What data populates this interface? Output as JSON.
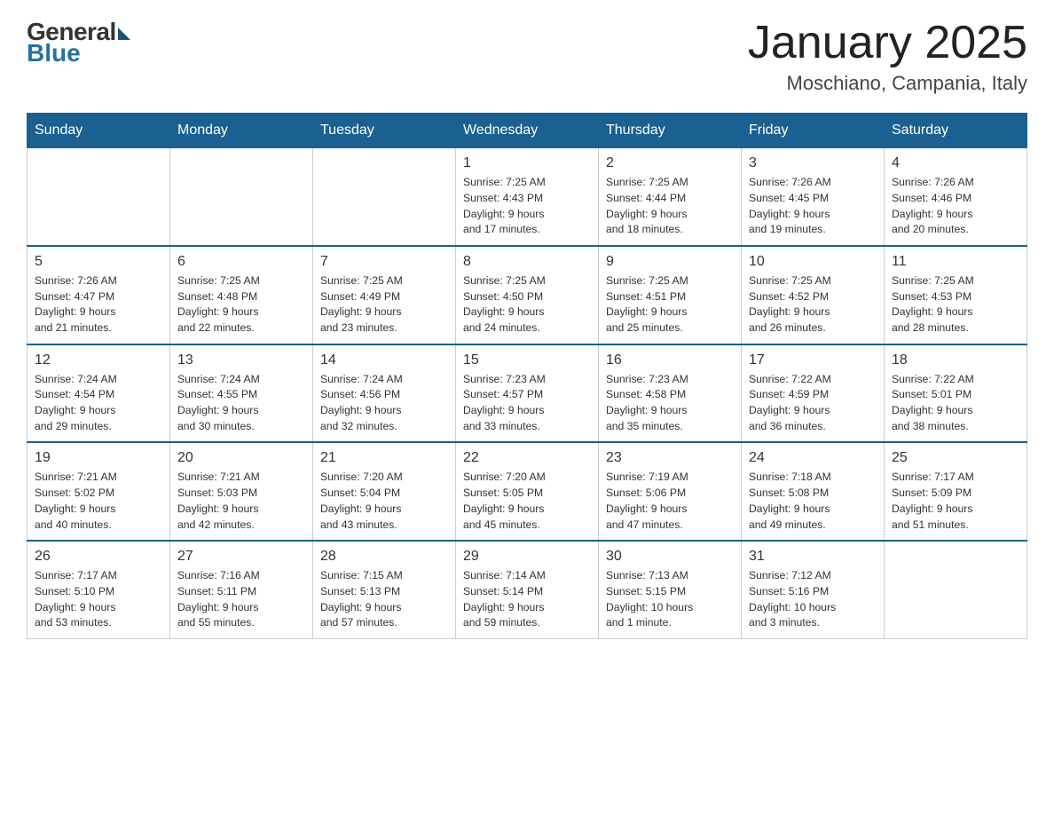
{
  "header": {
    "logo_general": "General",
    "logo_blue": "Blue",
    "month_title": "January 2025",
    "location": "Moschiano, Campania, Italy"
  },
  "days_of_week": [
    "Sunday",
    "Monday",
    "Tuesday",
    "Wednesday",
    "Thursday",
    "Friday",
    "Saturday"
  ],
  "weeks": [
    [
      {
        "day": "",
        "info": ""
      },
      {
        "day": "",
        "info": ""
      },
      {
        "day": "",
        "info": ""
      },
      {
        "day": "1",
        "info": "Sunrise: 7:25 AM\nSunset: 4:43 PM\nDaylight: 9 hours\nand 17 minutes."
      },
      {
        "day": "2",
        "info": "Sunrise: 7:25 AM\nSunset: 4:44 PM\nDaylight: 9 hours\nand 18 minutes."
      },
      {
        "day": "3",
        "info": "Sunrise: 7:26 AM\nSunset: 4:45 PM\nDaylight: 9 hours\nand 19 minutes."
      },
      {
        "day": "4",
        "info": "Sunrise: 7:26 AM\nSunset: 4:46 PM\nDaylight: 9 hours\nand 20 minutes."
      }
    ],
    [
      {
        "day": "5",
        "info": "Sunrise: 7:26 AM\nSunset: 4:47 PM\nDaylight: 9 hours\nand 21 minutes."
      },
      {
        "day": "6",
        "info": "Sunrise: 7:25 AM\nSunset: 4:48 PM\nDaylight: 9 hours\nand 22 minutes."
      },
      {
        "day": "7",
        "info": "Sunrise: 7:25 AM\nSunset: 4:49 PM\nDaylight: 9 hours\nand 23 minutes."
      },
      {
        "day": "8",
        "info": "Sunrise: 7:25 AM\nSunset: 4:50 PM\nDaylight: 9 hours\nand 24 minutes."
      },
      {
        "day": "9",
        "info": "Sunrise: 7:25 AM\nSunset: 4:51 PM\nDaylight: 9 hours\nand 25 minutes."
      },
      {
        "day": "10",
        "info": "Sunrise: 7:25 AM\nSunset: 4:52 PM\nDaylight: 9 hours\nand 26 minutes."
      },
      {
        "day": "11",
        "info": "Sunrise: 7:25 AM\nSunset: 4:53 PM\nDaylight: 9 hours\nand 28 minutes."
      }
    ],
    [
      {
        "day": "12",
        "info": "Sunrise: 7:24 AM\nSunset: 4:54 PM\nDaylight: 9 hours\nand 29 minutes."
      },
      {
        "day": "13",
        "info": "Sunrise: 7:24 AM\nSunset: 4:55 PM\nDaylight: 9 hours\nand 30 minutes."
      },
      {
        "day": "14",
        "info": "Sunrise: 7:24 AM\nSunset: 4:56 PM\nDaylight: 9 hours\nand 32 minutes."
      },
      {
        "day": "15",
        "info": "Sunrise: 7:23 AM\nSunset: 4:57 PM\nDaylight: 9 hours\nand 33 minutes."
      },
      {
        "day": "16",
        "info": "Sunrise: 7:23 AM\nSunset: 4:58 PM\nDaylight: 9 hours\nand 35 minutes."
      },
      {
        "day": "17",
        "info": "Sunrise: 7:22 AM\nSunset: 4:59 PM\nDaylight: 9 hours\nand 36 minutes."
      },
      {
        "day": "18",
        "info": "Sunrise: 7:22 AM\nSunset: 5:01 PM\nDaylight: 9 hours\nand 38 minutes."
      }
    ],
    [
      {
        "day": "19",
        "info": "Sunrise: 7:21 AM\nSunset: 5:02 PM\nDaylight: 9 hours\nand 40 minutes."
      },
      {
        "day": "20",
        "info": "Sunrise: 7:21 AM\nSunset: 5:03 PM\nDaylight: 9 hours\nand 42 minutes."
      },
      {
        "day": "21",
        "info": "Sunrise: 7:20 AM\nSunset: 5:04 PM\nDaylight: 9 hours\nand 43 minutes."
      },
      {
        "day": "22",
        "info": "Sunrise: 7:20 AM\nSunset: 5:05 PM\nDaylight: 9 hours\nand 45 minutes."
      },
      {
        "day": "23",
        "info": "Sunrise: 7:19 AM\nSunset: 5:06 PM\nDaylight: 9 hours\nand 47 minutes."
      },
      {
        "day": "24",
        "info": "Sunrise: 7:18 AM\nSunset: 5:08 PM\nDaylight: 9 hours\nand 49 minutes."
      },
      {
        "day": "25",
        "info": "Sunrise: 7:17 AM\nSunset: 5:09 PM\nDaylight: 9 hours\nand 51 minutes."
      }
    ],
    [
      {
        "day": "26",
        "info": "Sunrise: 7:17 AM\nSunset: 5:10 PM\nDaylight: 9 hours\nand 53 minutes."
      },
      {
        "day": "27",
        "info": "Sunrise: 7:16 AM\nSunset: 5:11 PM\nDaylight: 9 hours\nand 55 minutes."
      },
      {
        "day": "28",
        "info": "Sunrise: 7:15 AM\nSunset: 5:13 PM\nDaylight: 9 hours\nand 57 minutes."
      },
      {
        "day": "29",
        "info": "Sunrise: 7:14 AM\nSunset: 5:14 PM\nDaylight: 9 hours\nand 59 minutes."
      },
      {
        "day": "30",
        "info": "Sunrise: 7:13 AM\nSunset: 5:15 PM\nDaylight: 10 hours\nand 1 minute."
      },
      {
        "day": "31",
        "info": "Sunrise: 7:12 AM\nSunset: 5:16 PM\nDaylight: 10 hours\nand 3 minutes."
      },
      {
        "day": "",
        "info": ""
      }
    ]
  ]
}
